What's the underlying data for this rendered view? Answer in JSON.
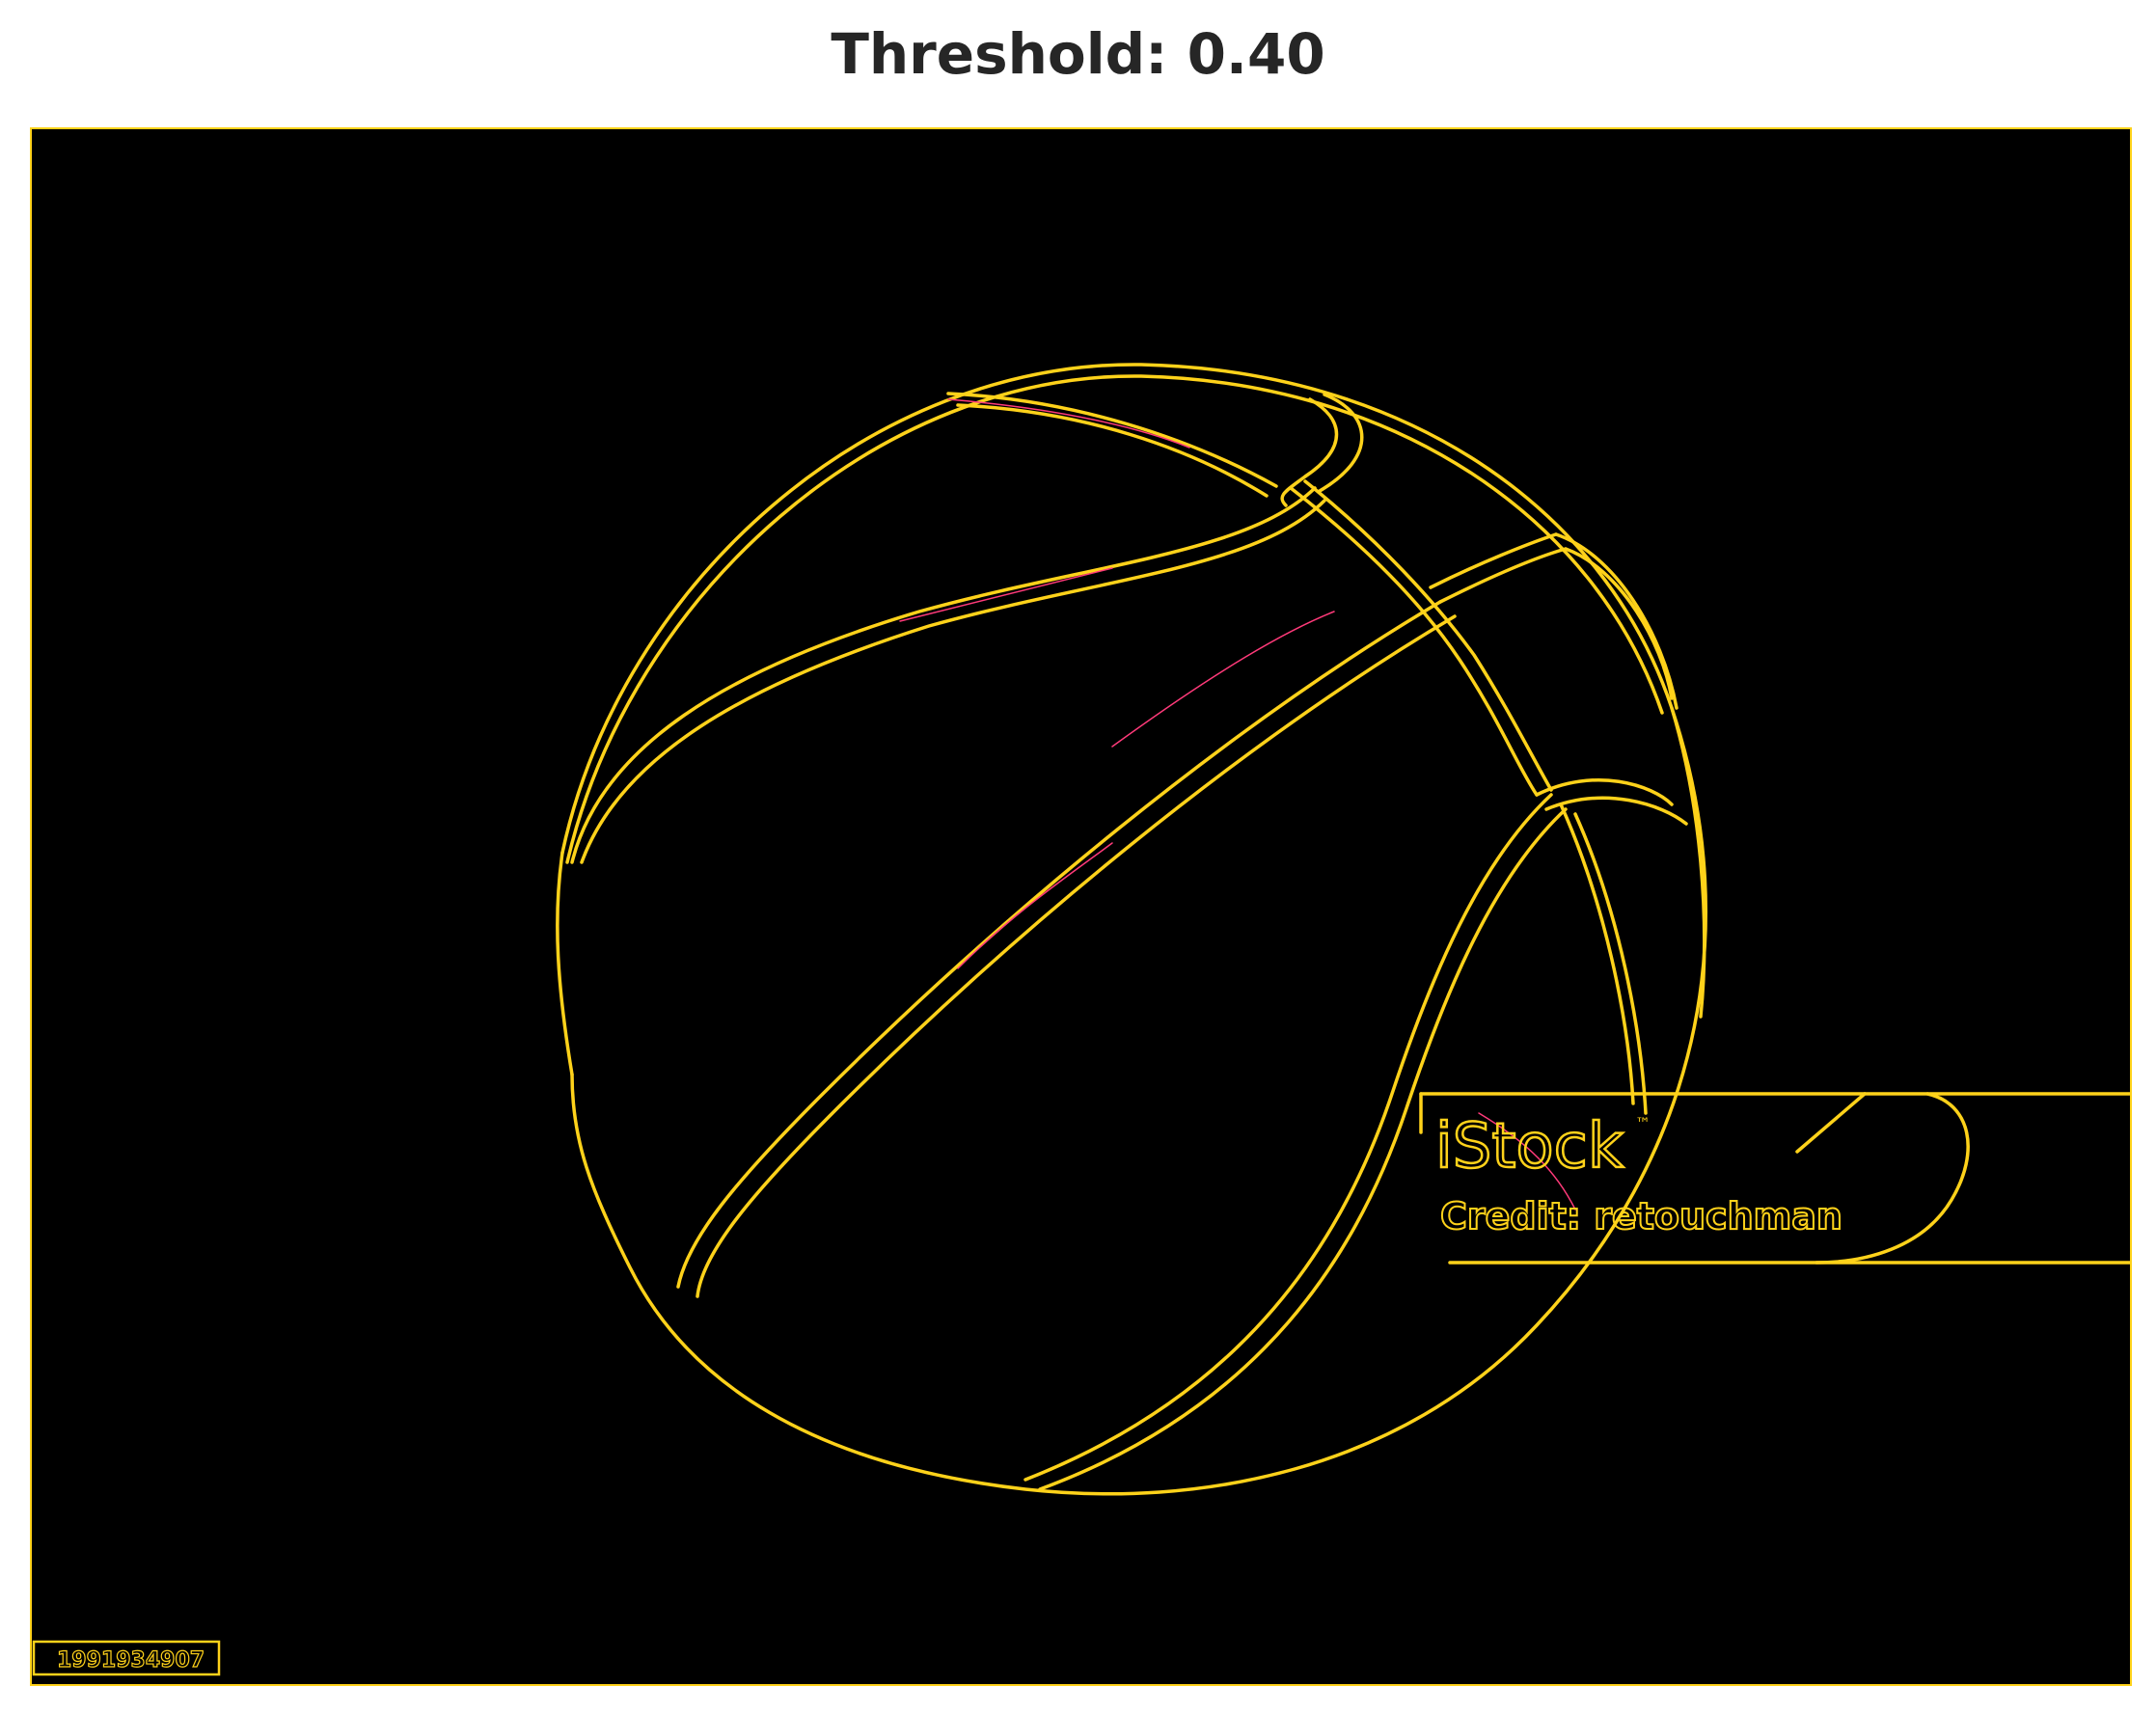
{
  "title": "Threshold: 0.40",
  "image": {
    "description_icon": "edge-detection-basketball-icon",
    "watermark_brand": "iStock",
    "watermark_trademark": "™",
    "watermark_credit": "Credit: retouchman",
    "image_id": "1991934907"
  },
  "colors": {
    "background": "#000000",
    "edge_primary": "#ffd21a",
    "edge_secondary": "#ff3a7a",
    "title": "#262626"
  }
}
